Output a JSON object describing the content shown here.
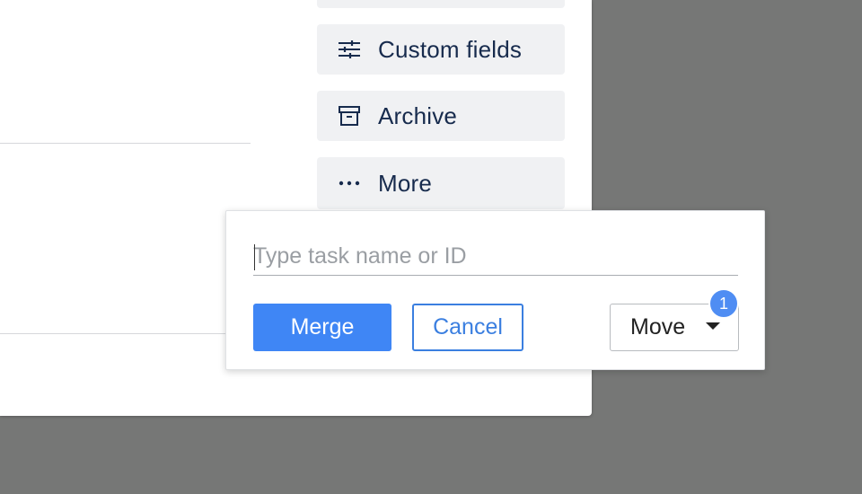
{
  "sidebar": {
    "items": [
      {
        "label": "Custom fields",
        "icon": "sliders-icon"
      },
      {
        "label": "Archive",
        "icon": "archive-box-icon"
      },
      {
        "label": "More",
        "icon": "ellipsis-icon"
      }
    ]
  },
  "merge_popover": {
    "search": {
      "value": "",
      "placeholder": "Type task name or ID"
    },
    "merge_label": "Merge",
    "cancel_label": "Cancel",
    "move_label": "Move",
    "move_badge_count": "1"
  },
  "colors": {
    "backdrop": "#767776",
    "primary": "#3f86f5",
    "badge": "#4f8df3",
    "text_dark": "#172b4d",
    "button_bg": "#f0f1f3"
  }
}
